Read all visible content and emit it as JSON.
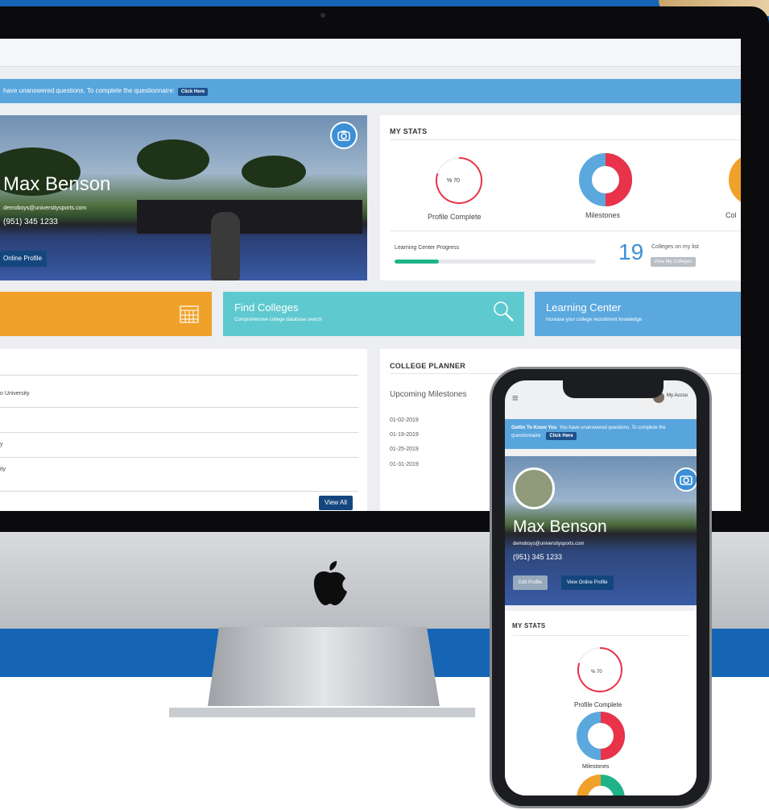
{
  "colors": {
    "brand_blue": "#1565b4",
    "alert_blue": "#58a4dc",
    "dark_button": "#14467e",
    "orange_tile": "#f0a129",
    "teal_tile": "#5ec9cf",
    "blue_tile": "#5aa8de",
    "progress_green": "#20b38a",
    "donut_red": "#e8334a",
    "donut_blue": "#5aa8de"
  },
  "desktop": {
    "alert": {
      "text": "have unanswered questions. To complete the questionnaire:",
      "button": "Click Here"
    },
    "profile": {
      "name": "Max Benson",
      "email": "demoboys@universitysports.com",
      "phone": "(951) 345 1233",
      "online_profile_button": "Online Profile",
      "camera_icon": "camera-icon"
    },
    "stats": {
      "title": "MY STATS",
      "profile_complete_value": "% 70",
      "profile_complete_fraction": 0.7,
      "profile_complete_label": "Profile Complete",
      "milestones_label": "Milestones",
      "colleges_label": "Col",
      "learning_center_label": "Learning Center Progress",
      "learning_center_fraction": 0.22,
      "colleges_count": "19",
      "colleges_count_label": "Colleges on my list",
      "view_colleges_button": "View My Colleges"
    },
    "tiles": [
      {
        "title": "",
        "subtitle": "",
        "icon": "calendar-icon"
      },
      {
        "title": "Find Colleges",
        "subtitle": "Comprehensive college database search",
        "icon": "search-icon"
      },
      {
        "title": "Learning Center",
        "subtitle": "Increase your college recruitment knowledge"
      }
    ],
    "college_list": {
      "rows": [
        "o University",
        "",
        "y",
        "ity"
      ],
      "view_all_button": "View All"
    },
    "planner": {
      "title": "COLLEGE PLANNER",
      "subtitle": "Upcoming Milestones",
      "dates": [
        "01-02-2019",
        "01-19-2019",
        "01-25-2019",
        "01-31-2019"
      ]
    }
  },
  "phone": {
    "account_label": "My Accou",
    "alert": {
      "strong": "Gettin To Know You",
      "text": "You have unanswered questions. To complete the questionnaire:",
      "button": "Click Here"
    },
    "profile": {
      "name": "Max Benson",
      "email": "demoboys@universitysports.com",
      "phone": "(951) 345 1233",
      "edit_button": "Edit Profile",
      "view_button": "View Online Profile"
    },
    "stats": {
      "title": "MY STATS",
      "profile_complete_value": "% 70",
      "profile_complete_label": "Profile Complete",
      "milestones_label": "Milestones"
    }
  }
}
